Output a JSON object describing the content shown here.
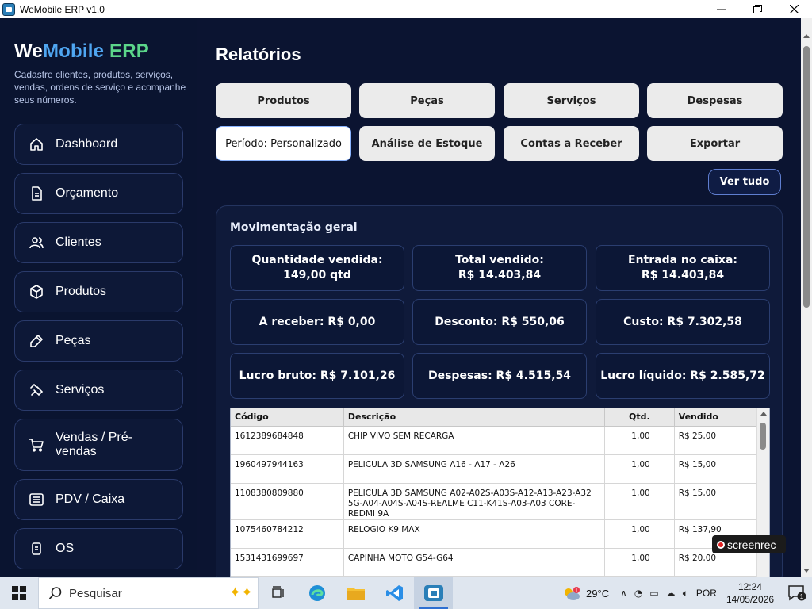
{
  "window": {
    "title": "WeMobile ERP v1.0"
  },
  "sidebar": {
    "logo": {
      "we": "We",
      "mobile": "Mobile",
      "erp": " ERP"
    },
    "tagline": "Cadastre clientes, produtos, serviços, vendas, ordens de serviço e acompanhe seus números.",
    "items": [
      {
        "label": "Dashboard",
        "icon": "home-icon"
      },
      {
        "label": "Orçamento",
        "icon": "document-icon"
      },
      {
        "label": "Clientes",
        "icon": "users-icon"
      },
      {
        "label": "Produtos",
        "icon": "box-icon"
      },
      {
        "label": "Peças",
        "icon": "tool-icon"
      },
      {
        "label": "Serviços",
        "icon": "wrench-icon"
      },
      {
        "label": "Vendas / Pré-vendas",
        "icon": "cart-icon"
      },
      {
        "label": "PDV / Caixa",
        "icon": "register-icon"
      },
      {
        "label": "OS",
        "icon": "clipboard-icon"
      }
    ]
  },
  "main": {
    "title": "Relatórios",
    "tabs": [
      {
        "label": "Produtos"
      },
      {
        "label": "Peças"
      },
      {
        "label": "Serviços"
      },
      {
        "label": "Despesas"
      },
      {
        "label": "Período: Personalizado"
      },
      {
        "label": "Análise de Estoque"
      },
      {
        "label": "Contas a Receber"
      },
      {
        "label": "Exportar"
      }
    ],
    "ver_tudo": "Ver tudo",
    "panel_title": "Movimentação geral",
    "stats": [
      {
        "line1": "Quantidade vendida:",
        "line2": "149,00 qtd"
      },
      {
        "line1": "Total vendido:",
        "line2": "R$ 14.403,84"
      },
      {
        "line1": "Entrada no caixa:",
        "line2": "R$ 14.403,84"
      },
      {
        "line1": "A receber: R$ 0,00",
        "line2": ""
      },
      {
        "line1": "Desconto: R$ 550,06",
        "line2": ""
      },
      {
        "line1": "Custo: R$ 7.302,58",
        "line2": ""
      },
      {
        "line1": "Lucro bruto: R$ 7.101,26",
        "line2": ""
      },
      {
        "line1": "Despesas: R$ 4.515,54",
        "line2": ""
      },
      {
        "line1": "Lucro líquido: R$ 2.585,72",
        "line2": ""
      }
    ],
    "table": {
      "headers": [
        "Código",
        "Descrição",
        "Qtd.",
        "Vendido"
      ],
      "rows": [
        [
          "1612389684848",
          "CHIP VIVO SEM RECARGA",
          "1,00",
          "R$ 25,00"
        ],
        [
          "1960497944163",
          "PELICULA 3D SAMSUNG A16 - A17 - A26",
          "1,00",
          "R$ 15,00"
        ],
        [
          "1108380809880",
          "PELICULA 3D SAMSUNG A02-A02S-A03S-A12-A13-A23-A32 5G-A04-A04S-A04S-REALME C11-K41S-A03-A03 CORE-REDMI 9A",
          "1,00",
          "R$ 15,00"
        ],
        [
          "1075460784212",
          "RELOGIO K9 MAX",
          "1,00",
          "R$ 137,90"
        ],
        [
          "1531431699697",
          "CAPINHA MOTO G54-G64",
          "1,00",
          "R$ 20,00"
        ],
        [
          "",
          "",
          "",
          ""
        ]
      ]
    }
  },
  "overlay": {
    "screenrec": "screenrec"
  },
  "taskbar": {
    "search_placeholder": "Pesquisar",
    "weather_temp": "29°C",
    "weather_badge": "1",
    "language": "POR",
    "time": "12:24",
    "date": "14/05/2026",
    "notification_count": "1"
  }
}
